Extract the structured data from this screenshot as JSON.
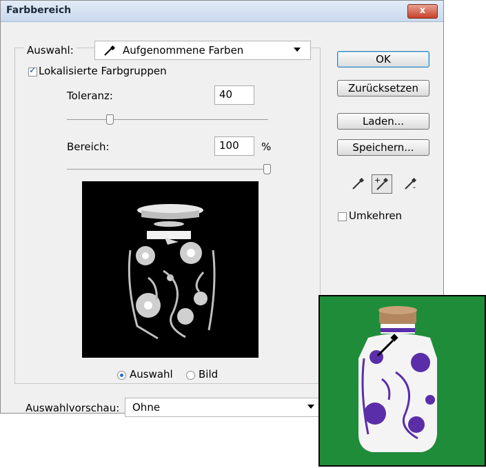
{
  "dialog": {
    "title": "Farbbereich",
    "close_label": "x"
  },
  "selection": {
    "label": "Auswahl:",
    "value": "Aufgenommene Farben"
  },
  "localized": {
    "label": "Lokalisierte Farbgruppen",
    "checked": true
  },
  "tolerance": {
    "label": "Toleranz:",
    "value": "40",
    "level": 40
  },
  "range": {
    "label": "Bereich:",
    "value": "100",
    "unit": "%",
    "level": 100
  },
  "view": {
    "option_selection": "Auswahl",
    "option_image": "Bild",
    "selected": "Auswahl"
  },
  "buttons": {
    "ok": "OK",
    "reset": "Zurücksetzen",
    "load": "Laden...",
    "save": "Speichern..."
  },
  "eyedroppers": [
    "eyedropper-icon",
    "eyedropper-plus-icon",
    "eyedropper-minus-icon"
  ],
  "invert": {
    "label": "Umkehren",
    "checked": false
  },
  "preview_mode": {
    "label": "Auswahlvorschau:",
    "value": "Ohne"
  },
  "colors": {
    "accent": "#2a6dc3",
    "inset_background": "#1f8c3a",
    "bottle_pattern": "#5a2ea8"
  }
}
